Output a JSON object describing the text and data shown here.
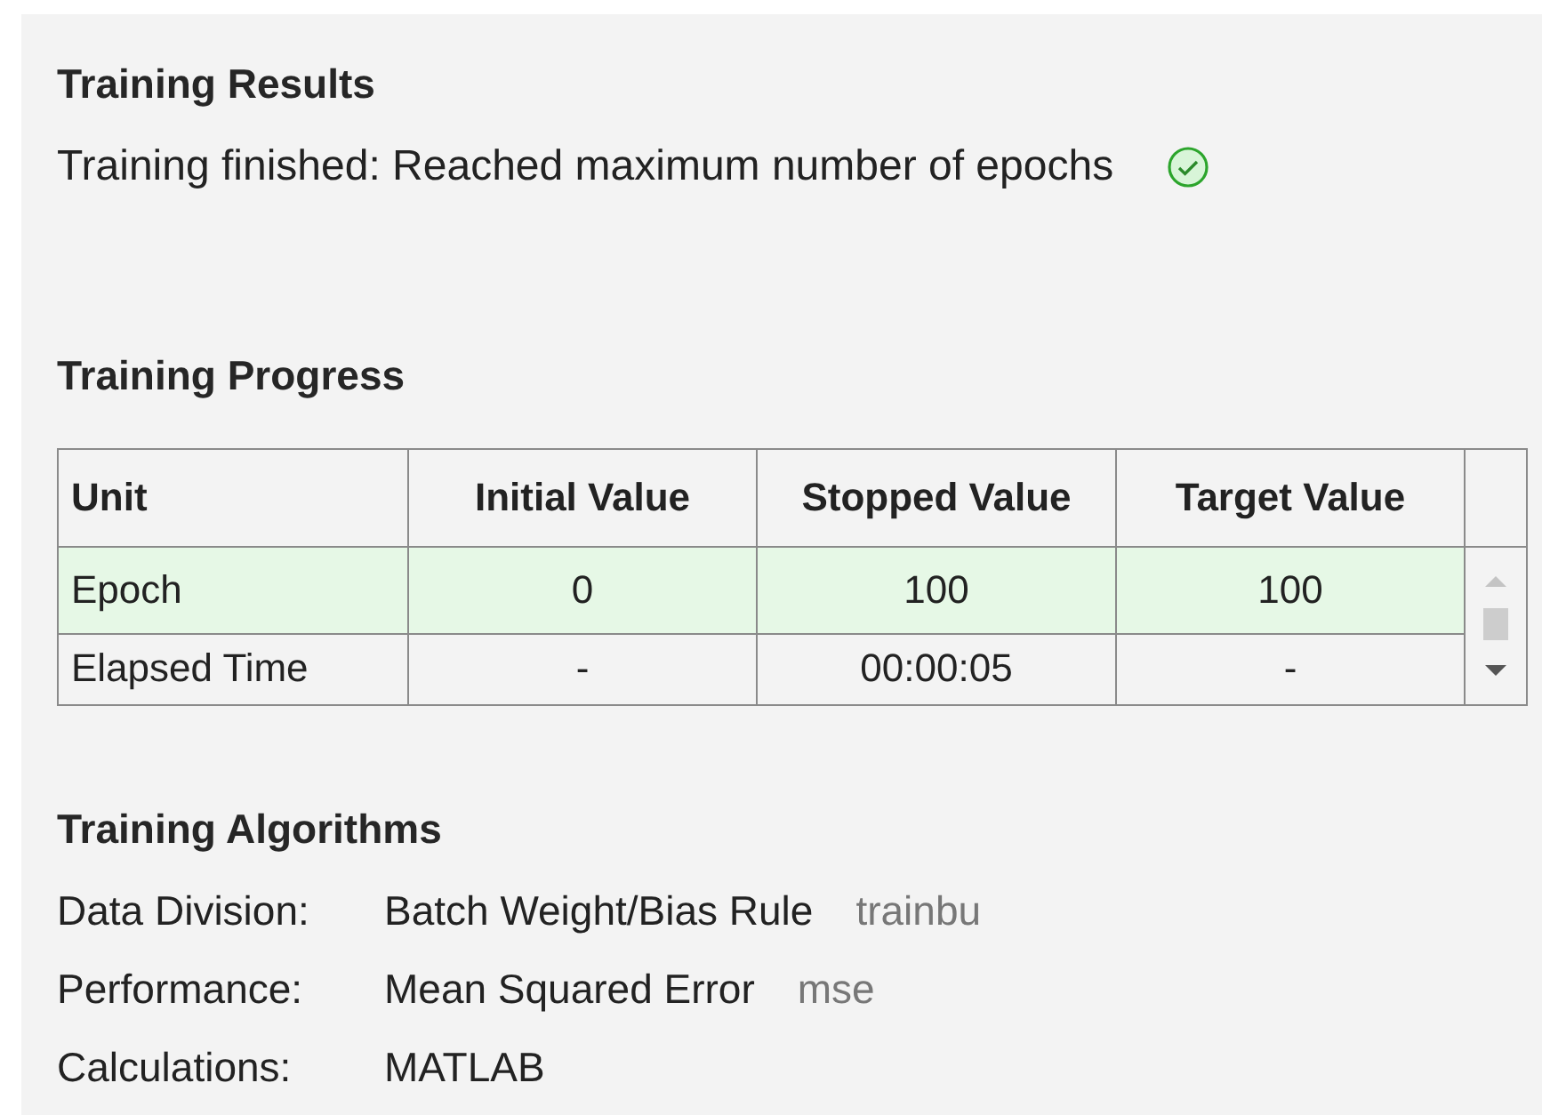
{
  "results": {
    "heading": "Training Results",
    "message": "Training finished: Reached maximum number of epochs",
    "kind": "success"
  },
  "progress": {
    "heading": "Training Progress",
    "columns": [
      "Unit",
      "Initial Value",
      "Stopped Value",
      "Target Value"
    ],
    "rows": [
      {
        "cells": [
          "Epoch",
          "0",
          "100",
          "100"
        ],
        "selected": true
      },
      {
        "cells": [
          "Elapsed Time",
          "-",
          "00:00:05",
          "-"
        ],
        "selected": false
      }
    ]
  },
  "algorithms": {
    "heading": "Training Algorithms",
    "items": [
      {
        "label": "Data Division:",
        "value": "Batch Weight/Bias Rule",
        "function": "trainbu"
      },
      {
        "label": "Performance:",
        "value": "Mean Squared Error",
        "function": "mse"
      },
      {
        "label": "Calculations:",
        "value": "MATLAB"
      }
    ]
  }
}
